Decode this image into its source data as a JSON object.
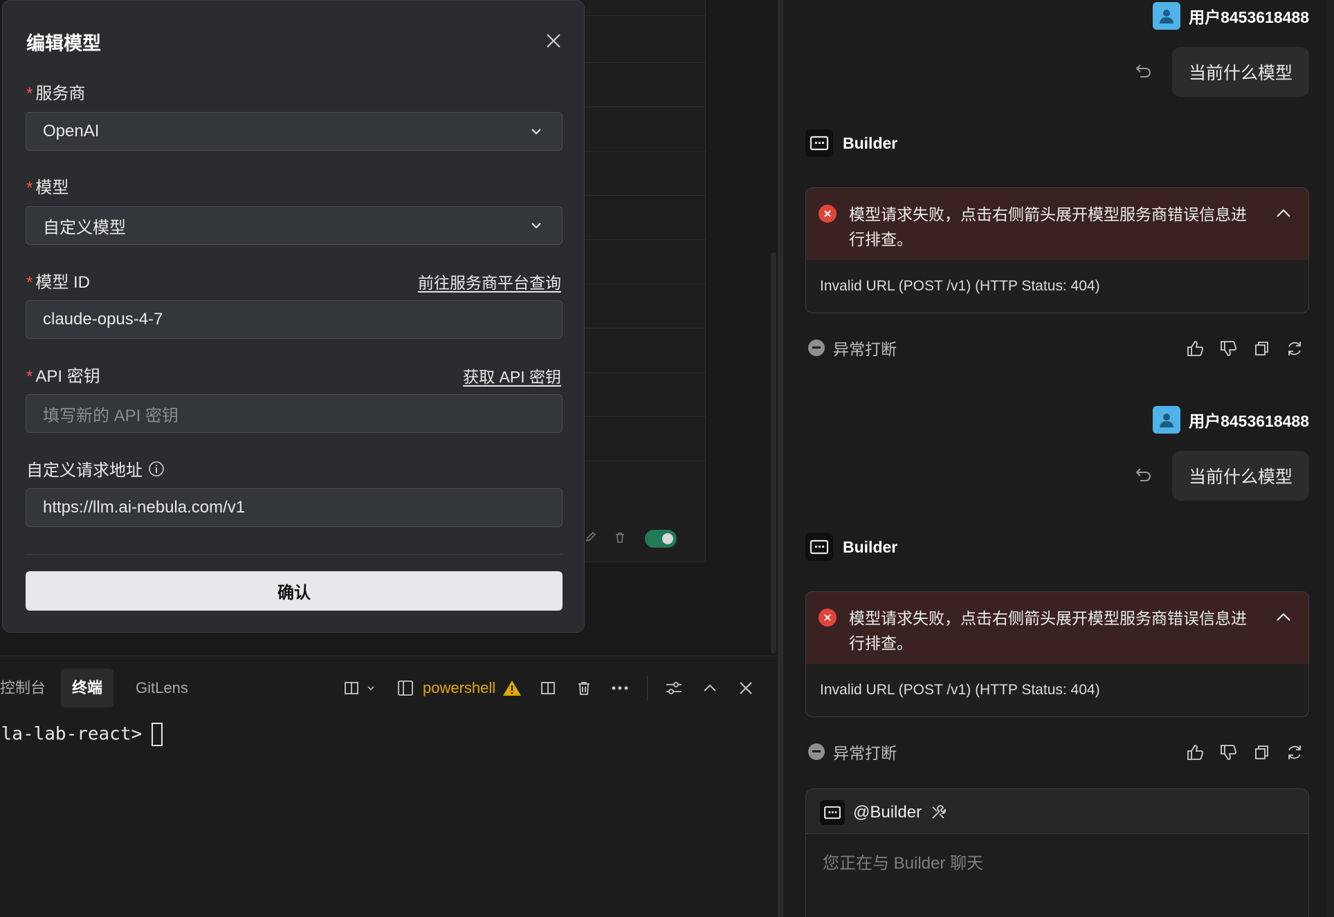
{
  "modal": {
    "title": "编辑模型",
    "required_mark": "*",
    "provider": {
      "label": "服务商",
      "value": "OpenAI"
    },
    "model": {
      "label": "模型",
      "value": "自定义模型"
    },
    "model_id": {
      "label": "模型 ID",
      "link": "前往服务商平台查询",
      "value": "claude-opus-4-7"
    },
    "api_key": {
      "label": "API 密钥",
      "link": "获取 API 密钥",
      "placeholder": "填写新的 API 密钥"
    },
    "custom_url": {
      "label": "自定义请求地址",
      "value": "https://llm.ai-nebula.com/v1"
    },
    "confirm_label": "确认"
  },
  "terminal": {
    "tabs": [
      "控制台",
      "终端",
      "GitLens"
    ],
    "shell_label": "powershell",
    "prompt": "ula-lab-react>"
  },
  "chat": {
    "messages": [
      {
        "user": "用户8453618488",
        "text": "当前什么模型",
        "bot": "Builder",
        "error_title": "模型请求失败，点击右侧箭头展开模型服务商错误信息进行排查。",
        "error_detail": "Invalid URL (POST /v1) (HTTP Status: 404)",
        "status": "异常打断"
      },
      {
        "user": "用户8453618488",
        "text": "当前什么模型",
        "bot": "Builder",
        "error_title": "模型请求失败，点击右侧箭头展开模型服务商错误信息进行排查。",
        "error_detail": "Invalid URL (POST /v1) (HTTP Status: 404)",
        "status": "异常打断"
      }
    ],
    "composer": {
      "mention": "@Builder",
      "placeholder": "您正在与 Builder 聊天"
    }
  },
  "icons": {
    "close": "close-icon",
    "chevron": "chevron-down-icon",
    "info": "info-icon",
    "undo": "undo-icon",
    "error": "error-circle-icon",
    "collapse": "chevron-up-icon",
    "stop": "stop-circle-icon",
    "like": "thumbs-up-icon",
    "dislike": "thumbs-down-icon",
    "copy": "copy-icon",
    "regenerate": "refresh-icon",
    "warning": "warning-icon"
  },
  "colors": {
    "error_accent": "#e0453a",
    "warning": "#e0a800",
    "avatar": "#4fb3e8",
    "toggle_on": "#1f7a55"
  }
}
